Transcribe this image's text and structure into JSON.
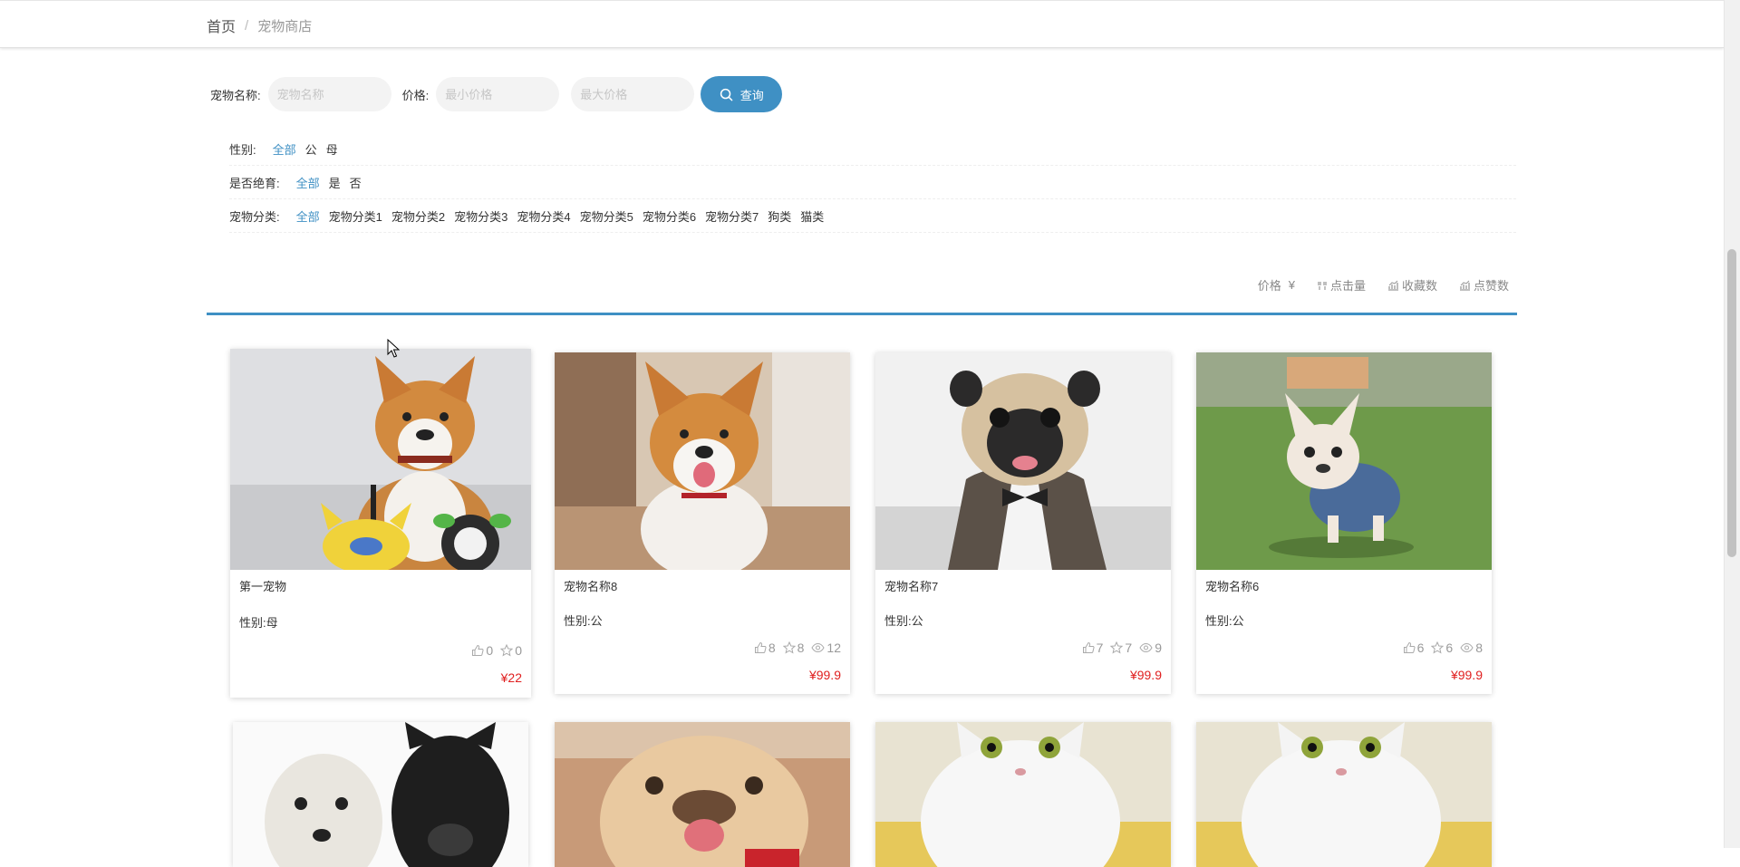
{
  "breadcrumb": {
    "home": "首页",
    "separator": "/",
    "current": "宠物商店"
  },
  "search": {
    "name_label": "宠物名称:",
    "name_placeholder": "宠物名称",
    "price_label": "价格:",
    "min_placeholder": "最小价格",
    "max_placeholder": "最大价格",
    "button_label": "查询"
  },
  "filters": {
    "gender": {
      "title": "性别:",
      "options": [
        "全部",
        "公",
        "母"
      ],
      "selected": "全部"
    },
    "sterilized": {
      "title": "是否绝育:",
      "options": [
        "全部",
        "是",
        "否"
      ],
      "selected": "全部"
    },
    "category": {
      "title": "宠物分类:",
      "options": [
        "全部",
        "宠物分类1",
        "宠物分类2",
        "宠物分类3",
        "宠物分类4",
        "宠物分类5",
        "宠物分类6",
        "宠物分类7",
        "狗类",
        "猫类"
      ],
      "selected": "全部"
    }
  },
  "sort": {
    "price": "价格",
    "price_symbol": "¥",
    "clicks": "点击量",
    "favorites": "收藏数",
    "likes": "点赞数"
  },
  "colors": {
    "accent": "#3f90c4",
    "price": "#e02020",
    "muted": "#999999"
  },
  "products": [
    {
      "name": "第一宠物",
      "sex": "性别:母",
      "likes": "0",
      "favorites": "0",
      "price": "¥22",
      "image": "corgi-with-toys"
    },
    {
      "name": "宠物名称8",
      "sex": "性别:公",
      "likes": "8",
      "favorites": "8",
      "views": "12",
      "price": "¥99.9",
      "image": "corgi-puppy"
    },
    {
      "name": "宠物名称7",
      "sex": "性别:公",
      "likes": "7",
      "favorites": "7",
      "views": "9",
      "price": "¥99.9",
      "image": "pug-in-suit"
    },
    {
      "name": "宠物名称6",
      "sex": "性别:公",
      "likes": "6",
      "favorites": "6",
      "views": "8",
      "price": "¥99.9",
      "image": "french-bulldog-on-grass"
    },
    {
      "image": "two-dogs"
    },
    {
      "image": "bulldog-face"
    },
    {
      "image": "white-persian-cat"
    },
    {
      "image": "white-persian-cat"
    }
  ]
}
